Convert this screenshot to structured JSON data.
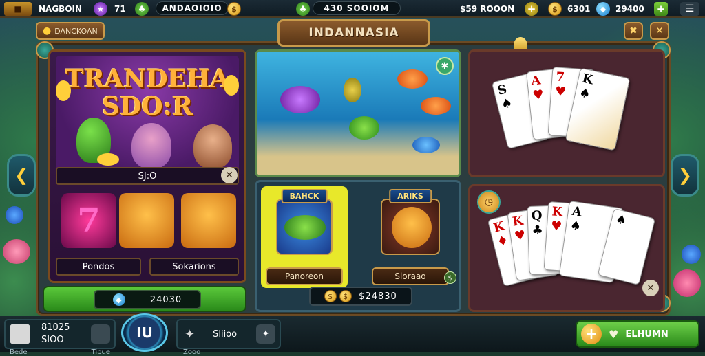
{
  "topbar": {
    "player_name": "NAGBOIN",
    "level": "71",
    "balance_1": "ANDAOIOIO",
    "balance_2": "430 SOOIOM",
    "bonus_label": "$59 ROOON",
    "gold": "6301",
    "gems": "29400"
  },
  "header": {
    "title": "INDANNASIA",
    "left_button_label": "DANCKOAN"
  },
  "left_panel": {
    "banner_title_line1": "TRANDEHA",
    "banner_title_line2": "SDO:R",
    "banner_label": "SJ:O",
    "tile_label_1": "Pondos",
    "tile_label_2": "Sokarions",
    "balance": "24030"
  },
  "middle": {
    "card_1_tag": "BAHCK",
    "card_1_label": "Panoreon",
    "card_2_tag": "ARIKS",
    "card_2_label": "Sloraao",
    "balance": "$24830"
  },
  "bottombar": {
    "stat_1_top": "81025",
    "stat_1_bottom": "SIOO",
    "stat_1_sub": "Bede",
    "stat_1_sub2": "Tibue",
    "center_label": "IU",
    "stat_2_top": "Sliioo",
    "stat_2_sub": "Zooo",
    "cta_label": "ELHUMN"
  },
  "colors": {
    "accent_gold": "#c89a4a",
    "green_button": "#4fb82a",
    "frame_wood": "#6b4a24"
  }
}
